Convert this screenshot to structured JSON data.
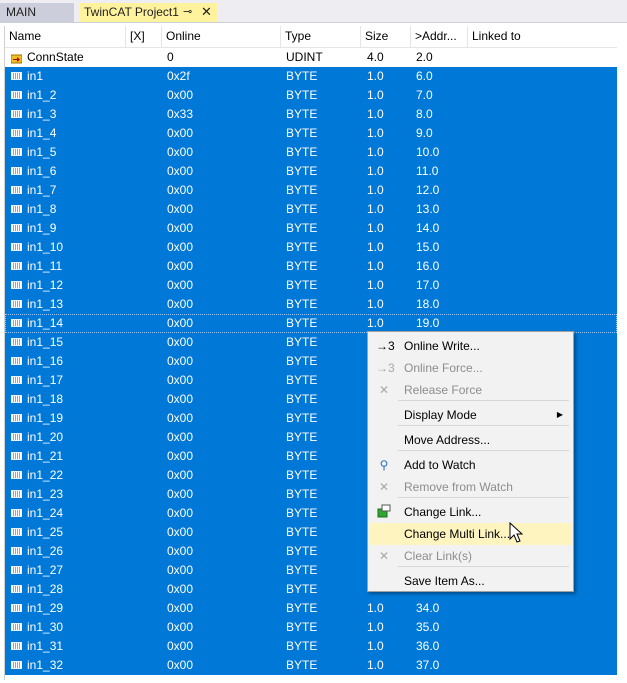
{
  "tabs": [
    {
      "label": "MAIN"
    },
    {
      "label": "TwinCAT Project1",
      "pin": "⊸",
      "close": "✕"
    }
  ],
  "columns": [
    "Name",
    "[X]",
    "Online",
    "Type",
    "Size",
    ">Addr...",
    "Linked to"
  ],
  "rows": [
    {
      "name": "ConnState",
      "online": "0",
      "type": "UDINT",
      "size": "4.0",
      "addr": "2.0",
      "icon": "conn-state-icon"
    },
    {
      "name": "in1",
      "online": "0x2f",
      "type": "BYTE",
      "size": "1.0",
      "addr": "6.0"
    },
    {
      "name": "in1_2",
      "online": "0x00",
      "type": "BYTE",
      "size": "1.0",
      "addr": "7.0"
    },
    {
      "name": "in1_3",
      "online": "0x33",
      "type": "BYTE",
      "size": "1.0",
      "addr": "8.0"
    },
    {
      "name": "in1_4",
      "online": "0x00",
      "type": "BYTE",
      "size": "1.0",
      "addr": "9.0"
    },
    {
      "name": "in1_5",
      "online": "0x00",
      "type": "BYTE",
      "size": "1.0",
      "addr": "10.0"
    },
    {
      "name": "in1_6",
      "online": "0x00",
      "type": "BYTE",
      "size": "1.0",
      "addr": "11.0"
    },
    {
      "name": "in1_7",
      "online": "0x00",
      "type": "BYTE",
      "size": "1.0",
      "addr": "12.0"
    },
    {
      "name": "in1_8",
      "online": "0x00",
      "type": "BYTE",
      "size": "1.0",
      "addr": "13.0"
    },
    {
      "name": "in1_9",
      "online": "0x00",
      "type": "BYTE",
      "size": "1.0",
      "addr": "14.0"
    },
    {
      "name": "in1_10",
      "online": "0x00",
      "type": "BYTE",
      "size": "1.0",
      "addr": "15.0"
    },
    {
      "name": "in1_11",
      "online": "0x00",
      "type": "BYTE",
      "size": "1.0",
      "addr": "16.0"
    },
    {
      "name": "in1_12",
      "online": "0x00",
      "type": "BYTE",
      "size": "1.0",
      "addr": "17.0"
    },
    {
      "name": "in1_13",
      "online": "0x00",
      "type": "BYTE",
      "size": "1.0",
      "addr": "18.0"
    },
    {
      "name": "in1_14",
      "online": "0x00",
      "type": "BYTE",
      "size": "1.0",
      "addr": "19.0"
    },
    {
      "name": "in1_15",
      "online": "0x00",
      "type": "BYTE",
      "size": "",
      "addr": ""
    },
    {
      "name": "in1_16",
      "online": "0x00",
      "type": "BYTE",
      "size": "",
      "addr": ""
    },
    {
      "name": "in1_17",
      "online": "0x00",
      "type": "BYTE",
      "size": "",
      "addr": ""
    },
    {
      "name": "in1_18",
      "online": "0x00",
      "type": "BYTE",
      "size": "",
      "addr": ""
    },
    {
      "name": "in1_19",
      "online": "0x00",
      "type": "BYTE",
      "size": "",
      "addr": ""
    },
    {
      "name": "in1_20",
      "online": "0x00",
      "type": "BYTE",
      "size": "",
      "addr": ""
    },
    {
      "name": "in1_21",
      "online": "0x00",
      "type": "BYTE",
      "size": "",
      "addr": ""
    },
    {
      "name": "in1_22",
      "online": "0x00",
      "type": "BYTE",
      "size": "",
      "addr": ""
    },
    {
      "name": "in1_23",
      "online": "0x00",
      "type": "BYTE",
      "size": "",
      "addr": ""
    },
    {
      "name": "in1_24",
      "online": "0x00",
      "type": "BYTE",
      "size": "",
      "addr": ""
    },
    {
      "name": "in1_25",
      "online": "0x00",
      "type": "BYTE",
      "size": "",
      "addr": ""
    },
    {
      "name": "in1_26",
      "online": "0x00",
      "type": "BYTE",
      "size": "",
      "addr": ""
    },
    {
      "name": "in1_27",
      "online": "0x00",
      "type": "BYTE",
      "size": "",
      "addr": ""
    },
    {
      "name": "in1_28",
      "online": "0x00",
      "type": "BYTE",
      "size": "",
      "addr": ""
    },
    {
      "name": "in1_29",
      "online": "0x00",
      "type": "BYTE",
      "size": "1.0",
      "addr": "34.0"
    },
    {
      "name": "in1_30",
      "online": "0x00",
      "type": "BYTE",
      "size": "1.0",
      "addr": "35.0"
    },
    {
      "name": "in1_31",
      "online": "0x00",
      "type": "BYTE",
      "size": "1.0",
      "addr": "36.0"
    },
    {
      "name": "in1_32",
      "online": "0x00",
      "type": "BYTE",
      "size": "1.0",
      "addr": "37.0"
    }
  ],
  "context_menu": {
    "items": [
      {
        "label": "Online Write...",
        "enabled": true,
        "icon": "online-write-icon",
        "glyph": "→3"
      },
      {
        "label": "Online Force...",
        "enabled": false,
        "icon": "online-force-icon",
        "glyph": "→3"
      },
      {
        "label": "Release Force",
        "enabled": false,
        "icon": "release-force-icon",
        "glyph": "✕"
      },
      {
        "label": "Display Mode",
        "enabled": true,
        "submenu": true
      },
      {
        "label": "Move Address...",
        "enabled": true
      },
      {
        "label": "Add to Watch",
        "enabled": true,
        "icon": "watch-icon",
        "glyph": "⚲"
      },
      {
        "label": "Remove from Watch",
        "enabled": false,
        "icon": "remove-watch-icon",
        "glyph": "✕"
      },
      {
        "label": "Change Link...",
        "enabled": true,
        "icon": "change-link-icon"
      },
      {
        "label": "Change Multi Link...",
        "enabled": true,
        "highlighted": true
      },
      {
        "label": "Clear Link(s)",
        "enabled": false,
        "icon": "clear-link-icon",
        "glyph": "✕"
      },
      {
        "label": "Save Item As...",
        "enabled": true
      }
    ]
  },
  "colors": {
    "selection": "#0078d7",
    "menu_hover": "#fdf4bf",
    "active_tab": "#fff29d"
  }
}
